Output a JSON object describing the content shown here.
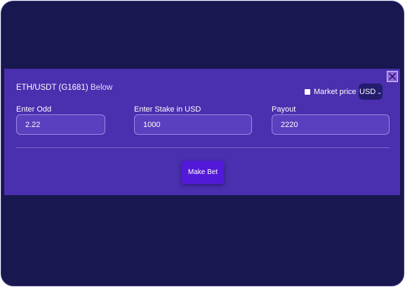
{
  "modal": {
    "pair": "ETH/USDT (G1681)",
    "direction": "Below",
    "close_icon": "close-icon",
    "market_price_label": "Market price",
    "currency": "USD"
  },
  "fields": {
    "odd_label": "Enter Odd",
    "odd_value": "2.22",
    "stake_label": "Enter Stake in USD",
    "stake_value": "1000",
    "payout_label": "Payout",
    "payout_value": "2220"
  },
  "actions": {
    "make_bet_label": "Make Bet"
  },
  "colors": {
    "background": "#19174f",
    "modal": "#4a2fae",
    "button": "#5319d8"
  }
}
